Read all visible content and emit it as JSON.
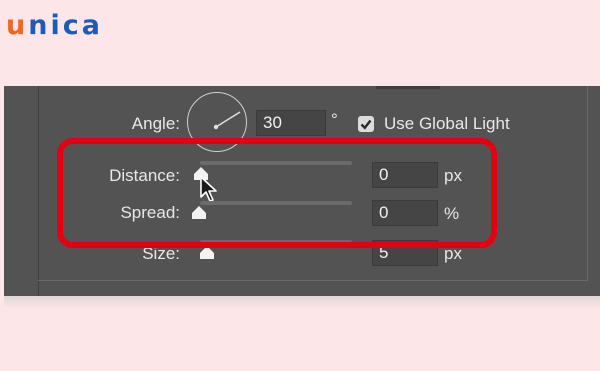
{
  "brand": {
    "first_letter": "u",
    "rest": "nica"
  },
  "panel": {
    "angle": {
      "label": "Angle:",
      "value": "30",
      "unit": "°"
    },
    "use_global_light": {
      "label": "Use Global Light",
      "checked": true
    },
    "distance": {
      "label": "Distance:",
      "value": "0",
      "unit": "px",
      "level": 0
    },
    "spread": {
      "label": "Spread:",
      "value": "0",
      "unit": "%",
      "level": 0
    },
    "size": {
      "label": "Size:",
      "value": "5",
      "unit": "px"
    }
  },
  "colors": {
    "highlight": "#e5000f",
    "panel": "#535353",
    "brand_orange": "#f26522",
    "brand_blue": "#1e5bb8"
  }
}
